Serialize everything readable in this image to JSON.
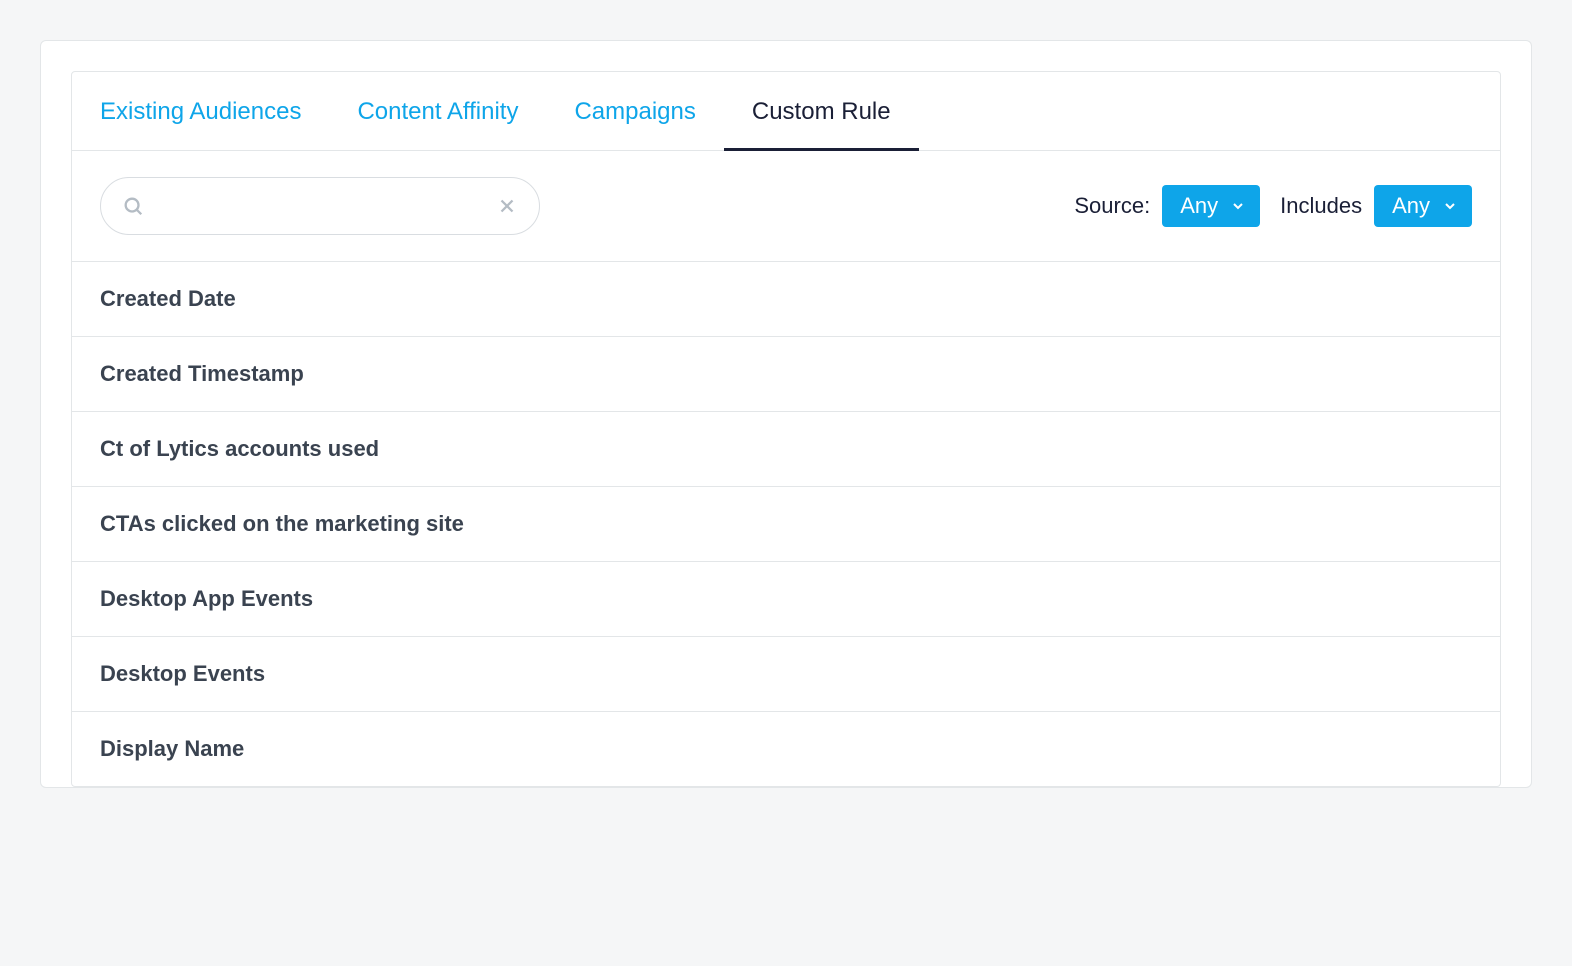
{
  "tabs": [
    {
      "label": "Existing Audiences",
      "active": false
    },
    {
      "label": "Content Affinity",
      "active": false
    },
    {
      "label": "Campaigns",
      "active": false
    },
    {
      "label": "Custom Rule",
      "active": true
    }
  ],
  "search": {
    "value": "",
    "placeholder": ""
  },
  "filters": {
    "source": {
      "label": "Source:",
      "value": "Any"
    },
    "includes": {
      "label": "Includes",
      "value": "Any"
    }
  },
  "items": [
    "Created Date",
    "Created Timestamp",
    "Ct of Lytics accounts used",
    "CTAs clicked on the marketing site",
    "Desktop App Events",
    "Desktop Events",
    "Display Name"
  ]
}
